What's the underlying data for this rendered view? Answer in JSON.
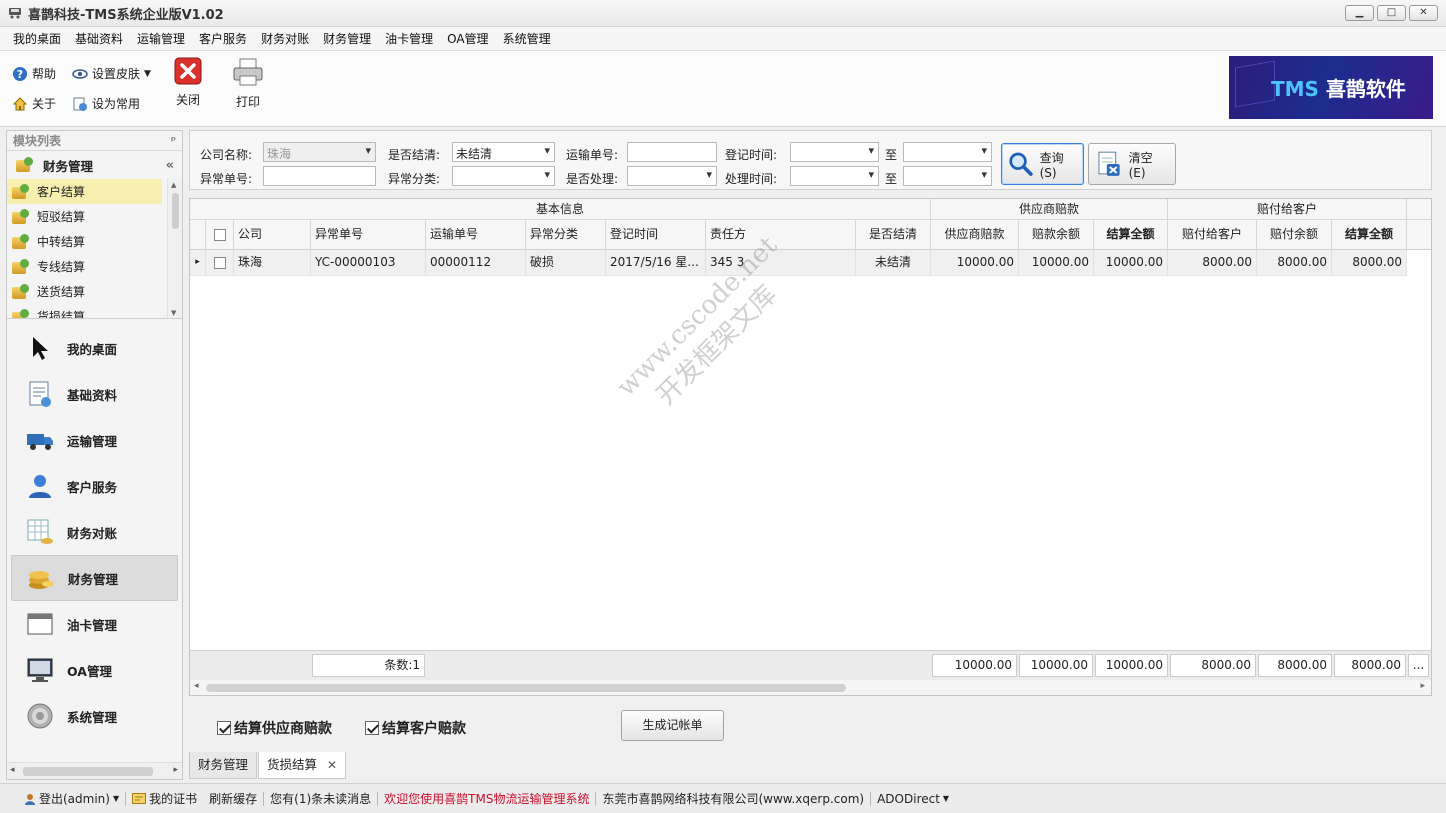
{
  "window": {
    "title": "喜鹊科技-TMS系统企业版V1.02",
    "controls": [
      "▁",
      "□",
      "✕"
    ]
  },
  "menu": [
    "我的桌面",
    "基础资料",
    "运输管理",
    "客户服务",
    "财务对账",
    "财务管理",
    "油卡管理",
    "OA管理",
    "系统管理"
  ],
  "ribbon": {
    "help": "帮助",
    "skin": "设置皮肤",
    "about": "关于",
    "set_common": "设为常用",
    "close": "关闭",
    "print": "打印",
    "brand": {
      "tms": "TMS",
      "name": "喜鹊软件"
    }
  },
  "left_panel": {
    "header": "模块列表",
    "pin": "ᵖ",
    "group": "财务管理",
    "collapse": "«",
    "sub_items": [
      "客户结算",
      "短驳结算",
      "中转结算",
      "专线结算",
      "送货结算",
      "货损结算"
    ],
    "nav": [
      "我的桌面",
      "基础资料",
      "运输管理",
      "客户服务",
      "财务对账",
      "财务管理",
      "油卡管理",
      "OA管理",
      "系统管理"
    ]
  },
  "filter": {
    "company_label": "公司名称:",
    "company_value": "珠海",
    "settled_label": "是否结清:",
    "settled_value": "未结清",
    "transport_no_label": "运输单号:",
    "transport_no_value": "",
    "register_time_label": "登记时间:",
    "to1": "至",
    "exception_no_label": "异常单号:",
    "exception_no_value": "",
    "exception_type_label": "异常分类:",
    "processed_label": "是否处理:",
    "process_time_label": "处理时间:",
    "to2": "至",
    "query_btn": "查询(S)",
    "clear_btn": "清空(E)"
  },
  "grid": {
    "bands": {
      "basic": "基本信息",
      "supplier": "供应商赔款",
      "customer": "赔付给客户"
    },
    "columns": {
      "company": "公司",
      "exception_no": "异常单号",
      "transport_no": "运输单号",
      "exception_type": "异常分类",
      "register_time": "登记时间",
      "responsible": "责任方",
      "settled": "是否结清",
      "supplier_comp": "供应商赔款",
      "comp_balance": "赔款余额",
      "settle_all_1": "结算全额",
      "pay_customer": "赔付给客户",
      "pay_balance": "赔付余额",
      "settle_all_2": "结算全额"
    },
    "rows": [
      {
        "marker": "▸",
        "company": "珠海",
        "exception_no": "YC-00000103",
        "transport_no": "00000112",
        "exception_type": "破损",
        "register_time": "2017/5/16 星...",
        "responsible": "345 3",
        "settled": "未结清",
        "supplier_comp": "10000.00",
        "comp_balance": "10000.00",
        "settle_all_1": "10000.00",
        "pay_customer": "8000.00",
        "pay_balance": "8000.00",
        "settle_all_2": "8000.00"
      }
    ],
    "footer": {
      "count": "条数:1",
      "supplier_comp": "10000.00",
      "comp_balance": "10000.00",
      "settle_all_1": "10000.00",
      "pay_customer": "8000.00",
      "pay_balance": "8000.00",
      "settle_all_2": "8000.00",
      "more": "..."
    },
    "watermark": [
      "www.cscode.net",
      "开发框架文库"
    ]
  },
  "options": {
    "settle_supplier": "结算供应商赔款",
    "settle_customer": "结算客户赔款",
    "generate_btn": "生成记帐单"
  },
  "tabs": {
    "finance": "财务管理",
    "damage": "货损结算",
    "close": "✕"
  },
  "status": {
    "logout": "登出(admin)",
    "cert": "我的证书",
    "refresh": "刷新缓存",
    "messages": "您有(1)条未读消息",
    "welcome": "欢迎您使用喜鹊TMS物流运输管理系统",
    "company": "东莞市喜鹊网络科技有限公司(www.xqerp.com)",
    "mode": "ADODirect"
  },
  "colors": {
    "accent": "#3c7fd8",
    "active_item": "#f6efb0",
    "welcome_red": "#c8102e",
    "brand_bg": "#1c2d8e"
  }
}
